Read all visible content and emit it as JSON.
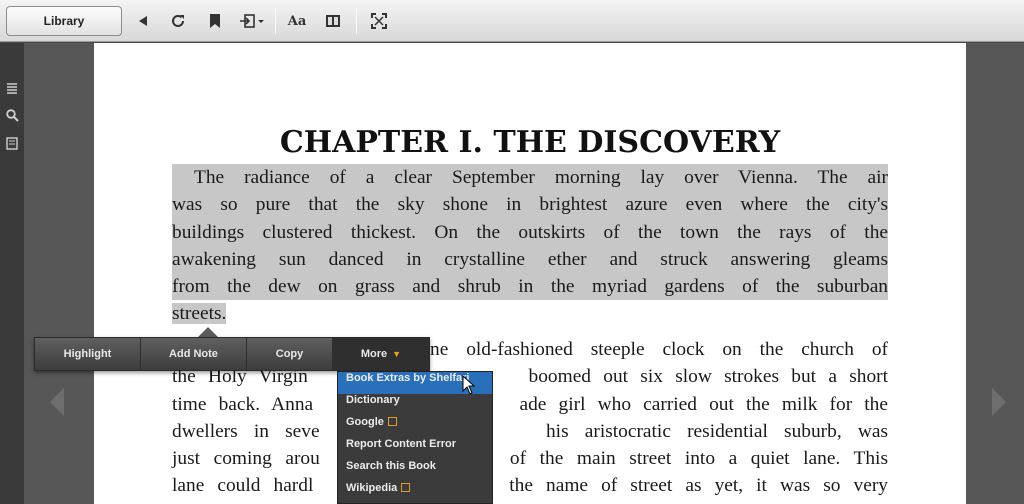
{
  "toolbar": {
    "library_label": "Library",
    "font_size_label": "Aa"
  },
  "page": {
    "chapter_title": "CHAPTER I. THE DISCOVERY",
    "para1_lines": [
      "The radiance of a clear September morning lay over Vienna. The air",
      "was so pure that the sky shone in brightest azure even where the city's",
      "buildings clustered thickest. On the outskirts of the town the rays of the",
      "awakening sun danced in crystalline ether and struck answering gleams",
      "from the dew on grass and shrub in the myriad gardens of the suburban",
      "streets."
    ],
    "para2_lines": [
      "ne old-fashioned steeple clock on the church of",
      "the Holy Virgin                  boomed out six slow strokes but a short",
      "time back. Anna                 ade girl who carried out the milk for the",
      "dwellers in seve              his aristocratic residential suburb, was",
      "just coming arou              of the main street into a quiet lane. This",
      "lane could hardl               the name of street as yet, it was so very"
    ]
  },
  "context_menu": {
    "highlight": "Highlight",
    "add_note": "Add Note",
    "copy": "Copy",
    "more": "More"
  },
  "more_menu": {
    "items": [
      "Book Extras by Shelfari",
      "Dictionary",
      "Google",
      "Report Content Error",
      "Search this Book",
      "Wikipedia"
    ]
  },
  "colors": {
    "highlight": "#c7c7c7",
    "menu_selected": "#2a6fba",
    "accent_orange": "#f0a020"
  }
}
